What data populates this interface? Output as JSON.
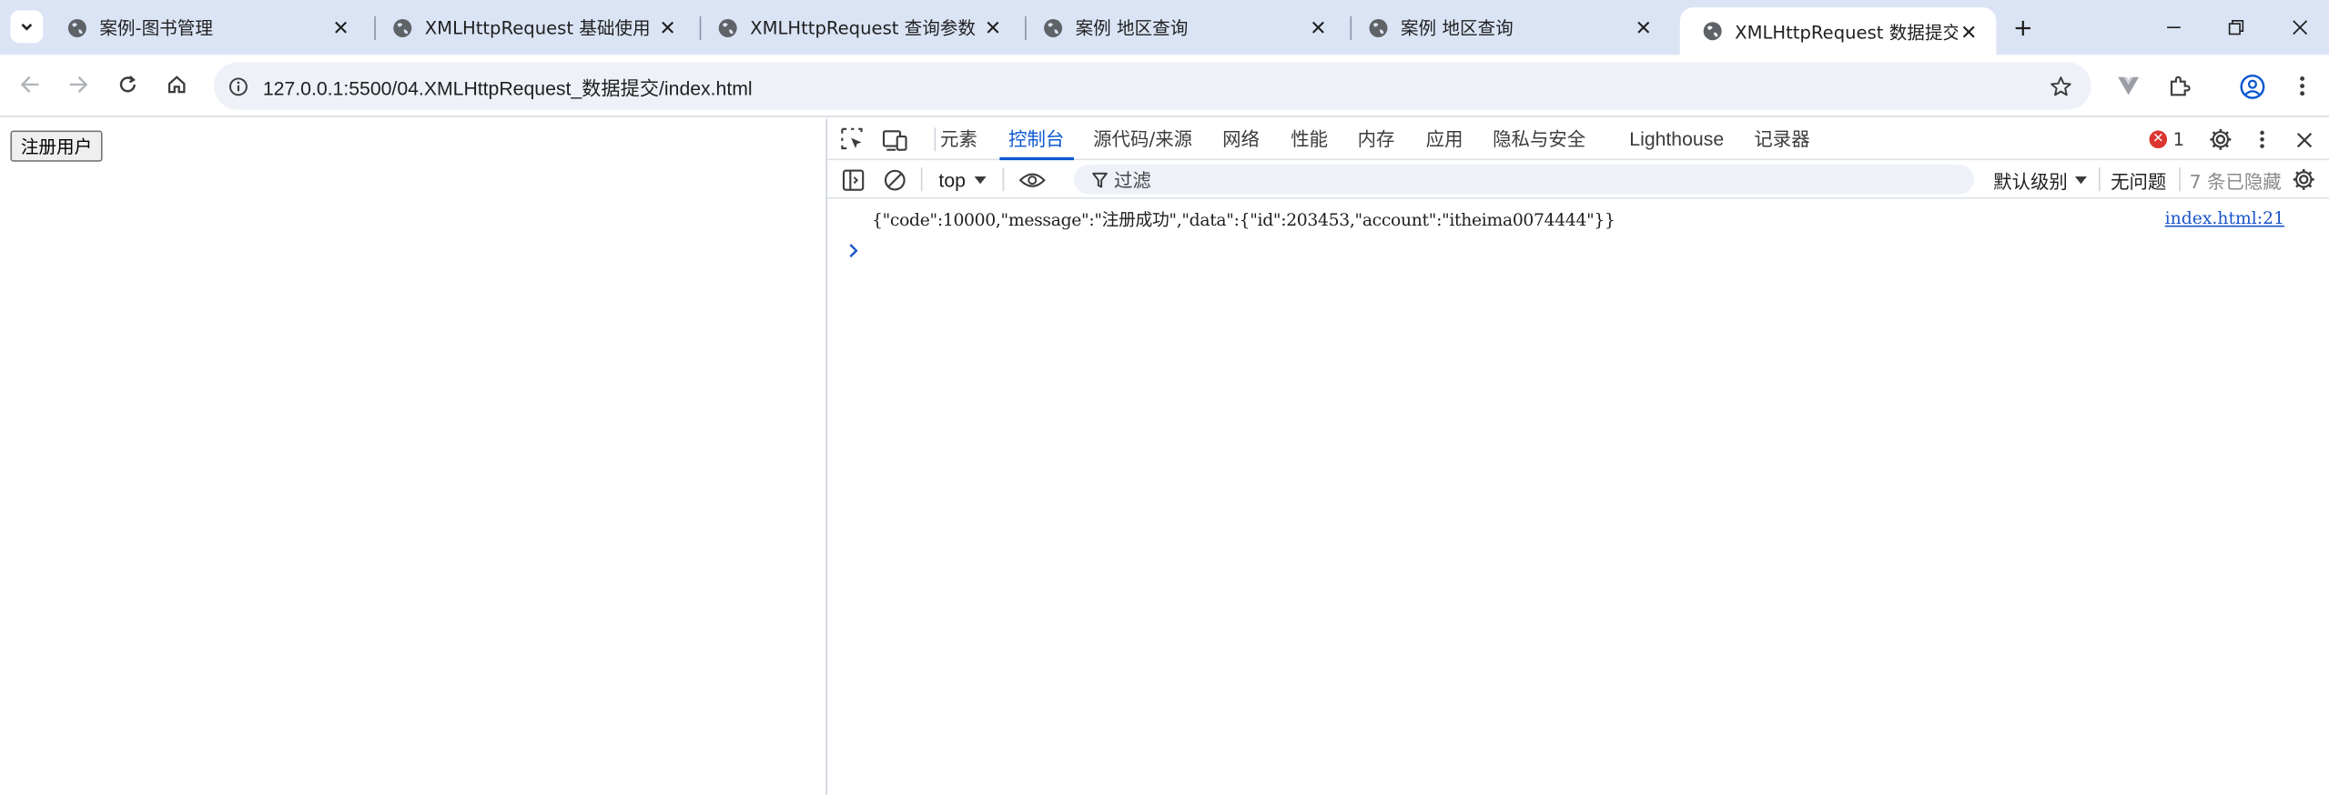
{
  "browser": {
    "tabs": [
      {
        "title": "案例-图书管理",
        "active": false
      },
      {
        "title": "XMLHttpRequest 基础使用",
        "active": false
      },
      {
        "title": "XMLHttpRequest 查询参数",
        "active": false
      },
      {
        "title": "案例 地区查询",
        "active": false
      },
      {
        "title": "案例 地区查询",
        "active": false
      },
      {
        "title": "XMLHttpRequest 数据提交",
        "active": true
      }
    ],
    "url": "127.0.0.1:5500/04.XMLHttpRequest_数据提交/index.html",
    "accent_color": "#0b57d0",
    "tabstrip_color": "#dbe4f5"
  },
  "page": {
    "register_button": "注册用户"
  },
  "devtools": {
    "tabs": [
      "元素",
      "控制台",
      "源代码/来源",
      "网络",
      "性能",
      "内存",
      "应用",
      "隐私与安全",
      "Lighthouse",
      "记录器"
    ],
    "active_tab": "控制台",
    "error_count": "1",
    "context": "top",
    "filter_placeholder": "过滤",
    "log_level": "默认级别",
    "issues": "无问题",
    "hidden_count": "7 条已隐藏",
    "console": {
      "message": "{\"code\":10000,\"message\":\"注册成功\",\"data\":{\"id\":203453,\"account\":\"itheima0074444\"}}",
      "source": "index.html:21"
    }
  }
}
